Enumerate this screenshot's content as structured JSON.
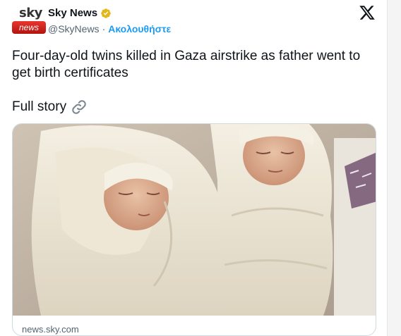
{
  "author": {
    "logo_top": "sky",
    "logo_bottom": "news",
    "display_name": "Sky News",
    "handle": "@SkyNews",
    "separator": "·",
    "follow_label": "Ακολουθήστε"
  },
  "tweet": {
    "text": "Four-day-old twins killed in Gaza airstrike as father went to get birth certificates",
    "link_text": "Full story"
  },
  "card": {
    "domain": "news.sky.com"
  },
  "icons": {
    "verified": "verified-gold-badge-icon",
    "platform": "x-logo-icon",
    "link": "link-chain-icon"
  },
  "colors": {
    "accent": "#1d9bf0",
    "verified": "#e2b719",
    "sky_red": "#c8102e"
  }
}
